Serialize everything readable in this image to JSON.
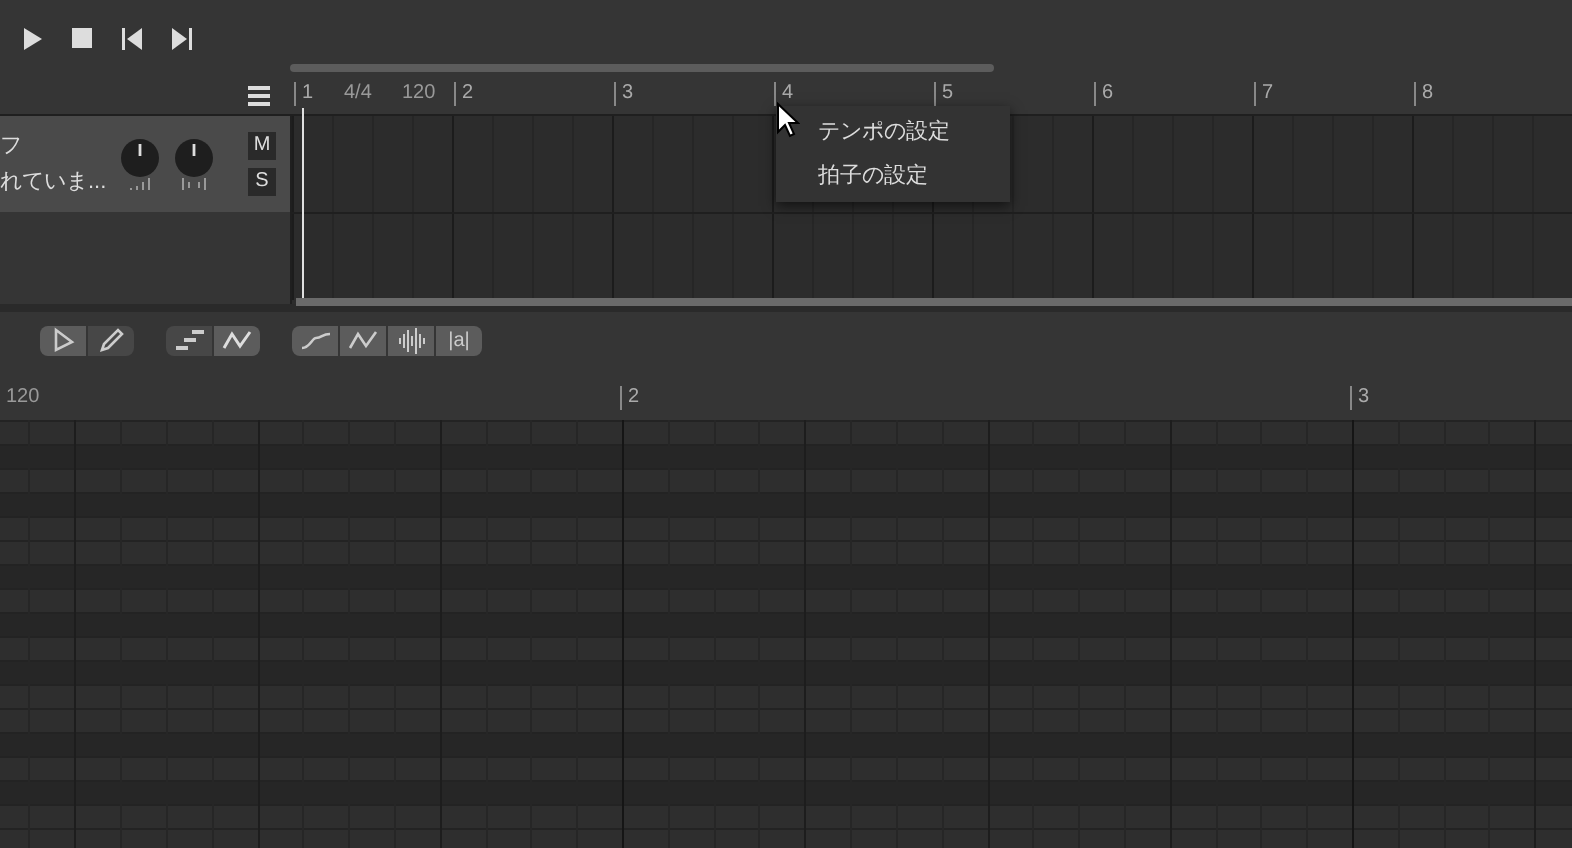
{
  "transport": {
    "buttons": [
      {
        "kind": "play"
      },
      {
        "kind": "stop"
      },
      {
        "kind": "previous"
      },
      {
        "kind": "next"
      }
    ]
  },
  "ruler": {
    "bars": [
      "1",
      "2",
      "3",
      "4",
      "5",
      "6",
      "7",
      "8"
    ],
    "time_signature": "4/4",
    "tempo": "120"
  },
  "track": {
    "name": "フ",
    "status": "れていま...",
    "mute": "M",
    "solo": "S"
  },
  "context_menu": {
    "items": [
      {
        "label": "テンポの設定"
      },
      {
        "label": "拍子の設定"
      }
    ]
  },
  "toolbar": {
    "groups": [
      [
        {
          "kind": "pointer",
          "selected": true
        },
        {
          "kind": "pencil",
          "selected": false
        }
      ],
      [
        {
          "kind": "steps",
          "selected": false
        },
        {
          "kind": "points",
          "selected": true
        }
      ],
      [
        {
          "kind": "curve",
          "selected": true
        },
        {
          "kind": "wave",
          "selected": true
        },
        {
          "kind": "waveform",
          "selected": true
        },
        {
          "kind": "lyric",
          "label": "|a|",
          "selected": true
        }
      ]
    ]
  },
  "piano_roll": {
    "tempo": "120",
    "bars": [
      "2",
      "3"
    ]
  }
}
